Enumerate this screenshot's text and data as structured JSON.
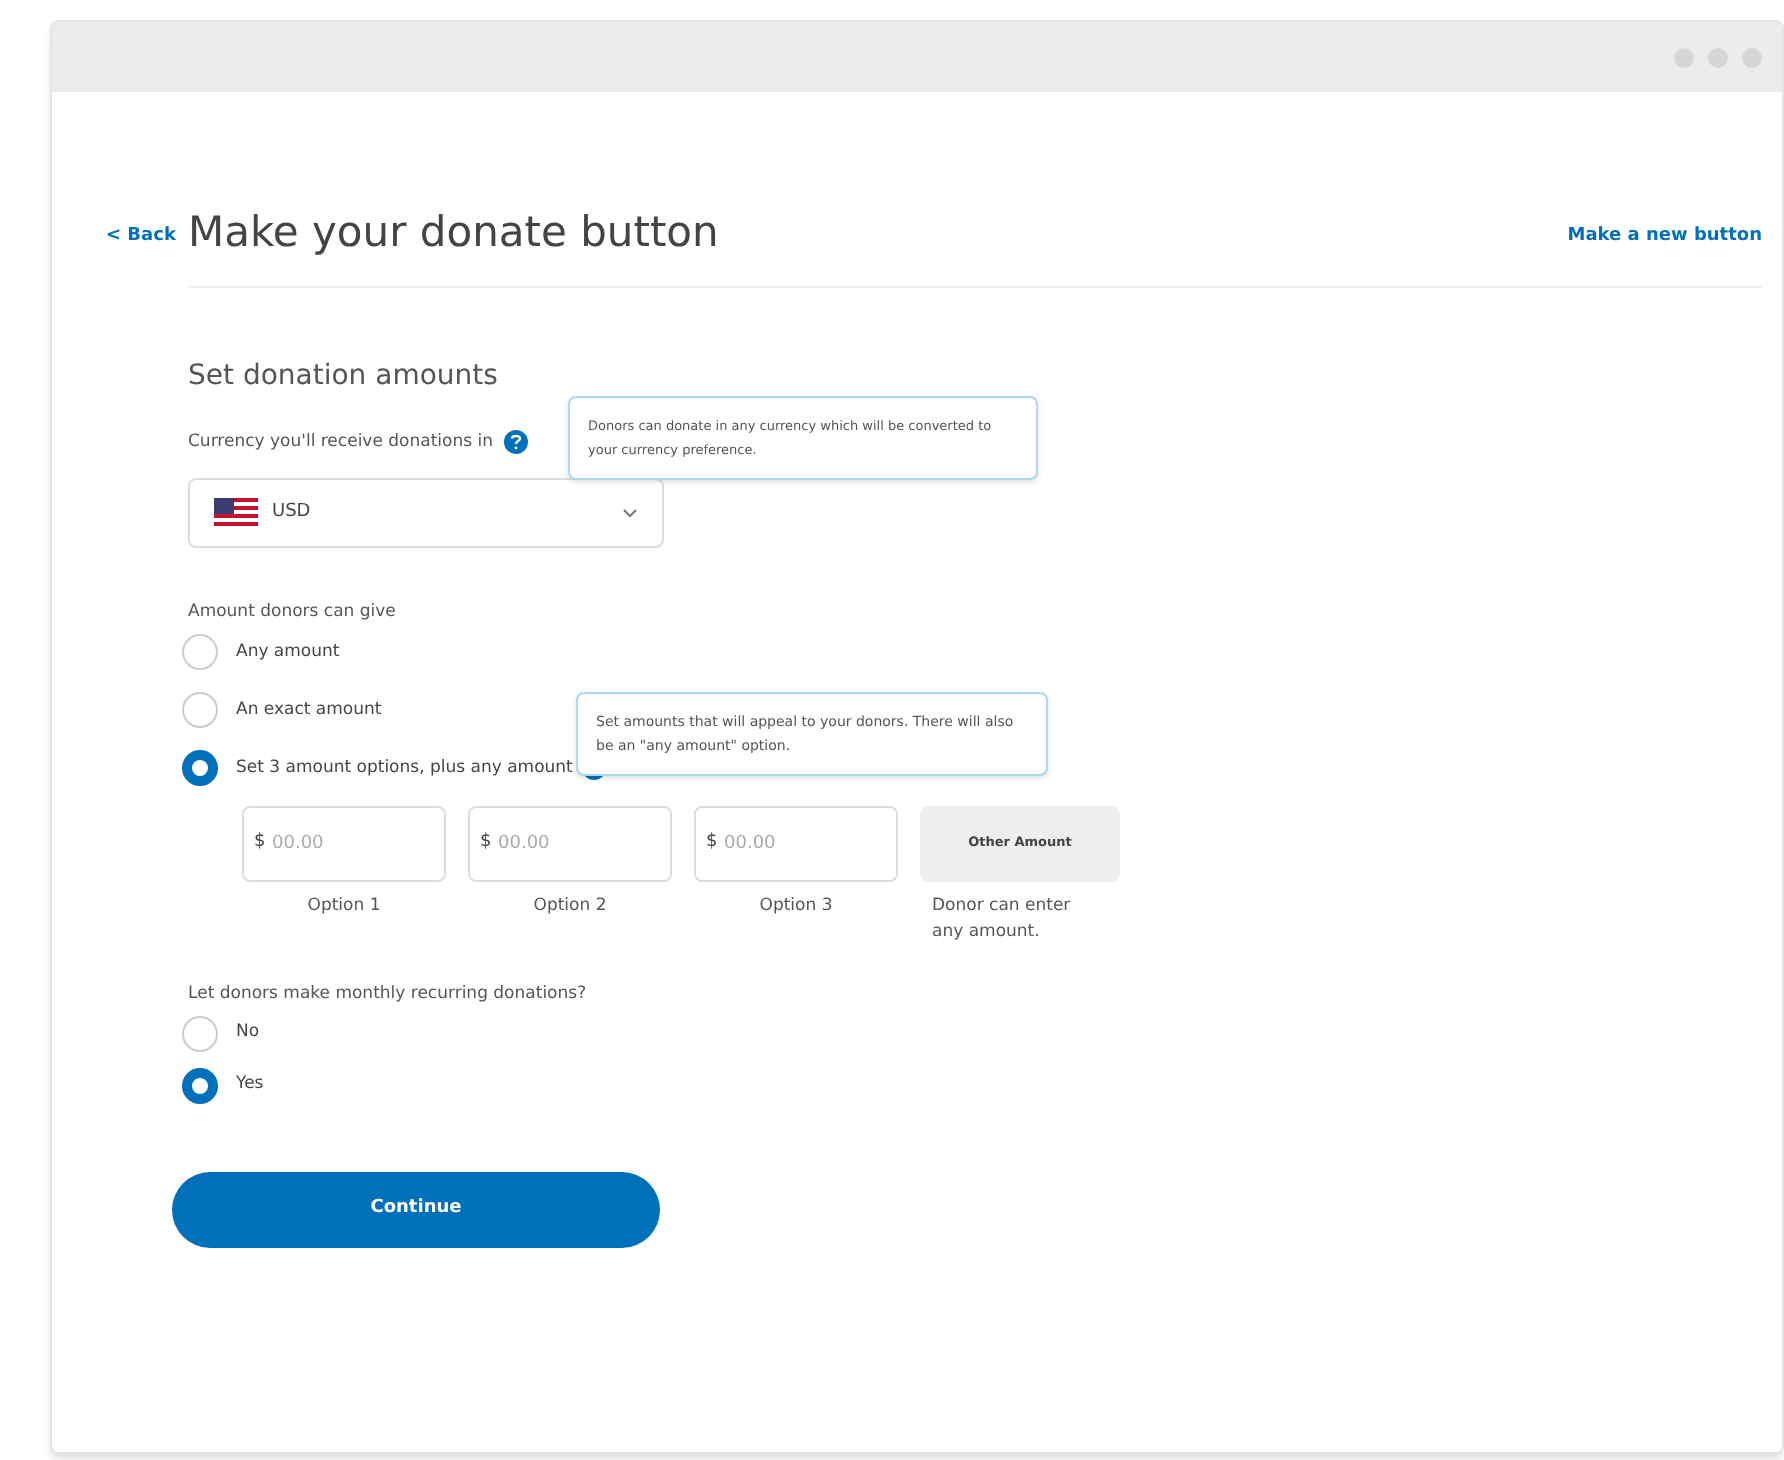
{
  "header": {
    "back_link": "< Back",
    "title": "Make your donate button",
    "new_button_link": "Make a new button"
  },
  "section_title": "Set donation amounts",
  "currency": {
    "label": "Currency you'll receive donations in",
    "tooltip": "Donors can donate in any currency which will be converted to your currency preference.",
    "value": "USD"
  },
  "amount": {
    "label": "Amount donors can give",
    "options": [
      {
        "label": "Any amount",
        "selected": false
      },
      {
        "label": "An exact amount",
        "selected": false
      },
      {
        "label": "Set 3 amount options, plus any amount",
        "selected": true
      }
    ],
    "tooltip": "Set amounts that will appeal to your donors. There will also be an \"any amount\" option.",
    "fields": [
      {
        "prefix": "$",
        "placeholder": "00.00",
        "caption": "Option 1"
      },
      {
        "prefix": "$",
        "placeholder": "00.00",
        "caption": "Option 2"
      },
      {
        "prefix": "$",
        "placeholder": "00.00",
        "caption": "Option 3"
      }
    ],
    "other": {
      "button": "Other Amount",
      "caption": "Donor can enter any amount."
    }
  },
  "recurring": {
    "label": "Let donors make monthly recurring donations?",
    "options": [
      {
        "label": "No",
        "selected": false
      },
      {
        "label": "Yes",
        "selected": true
      }
    ]
  },
  "continue_button": "Continue"
}
